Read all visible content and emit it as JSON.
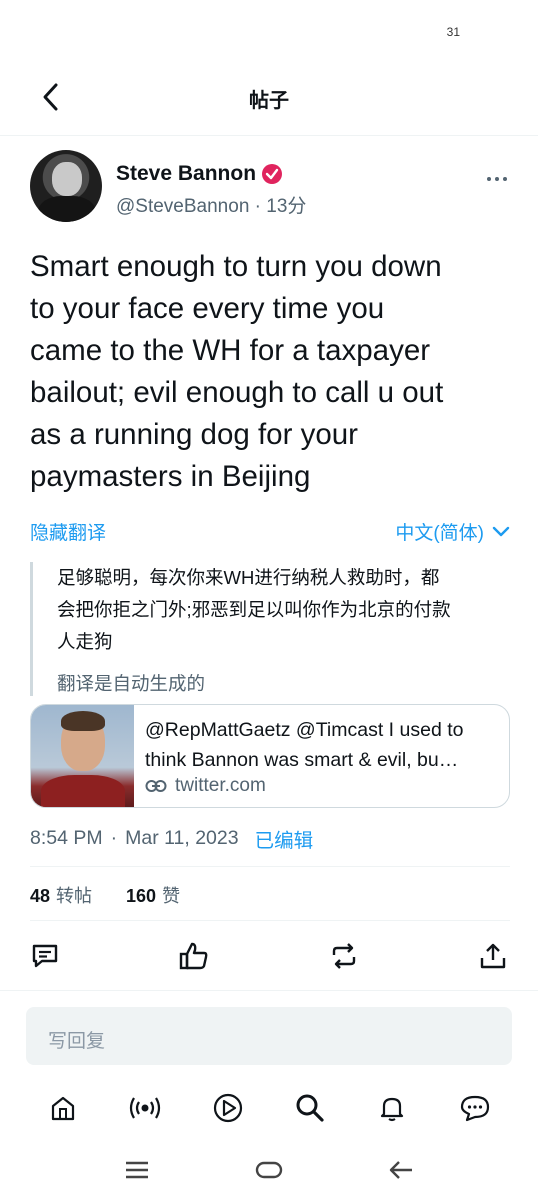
{
  "status_bar": {
    "number": "31"
  },
  "header": {
    "title": "帖子"
  },
  "author": {
    "name": "Steve Bannon",
    "handle": "@SteveBannon",
    "separator": "·",
    "time": "13分"
  },
  "tweet": {
    "lines": [
      "Smart enough to turn you down",
      "to your face every time you",
      "came to the WH for a taxpayer",
      "bailout; evil enough to call u out",
      "as a running dog for your",
      "paymasters in Beijing"
    ]
  },
  "translation": {
    "hide_label": "隐藏翻译",
    "language": "中文(简体)",
    "lines": [
      "足够聪明，每次你来WH进行纳税人救助时，都",
      "会把你拒之门外;邪恶到足以叫你作为北京的付款",
      "人走狗"
    ],
    "note": "翻译是自动生成的"
  },
  "quote": {
    "line1": "@RepMattGaetz @Timcast I used to",
    "line2": "think Bannon was smart & evil, bu…",
    "domain": "twitter.com"
  },
  "meta": {
    "time": "8:54 PM",
    "separator": "·",
    "date": "Mar 11, 2023",
    "edited": "已编辑"
  },
  "counts": {
    "retweets_value": "48",
    "retweets_label": "转帖",
    "likes_value": "160",
    "likes_label": "赞"
  },
  "actions": [
    "comment-icon",
    "thumbs-up-icon",
    "retweet-icon",
    "share-icon"
  ],
  "reply": {
    "placeholder": "写回复"
  },
  "bottom_nav": [
    "home-icon",
    "spaces-icon",
    "play-icon",
    "search-icon",
    "bell-icon",
    "messages-icon"
  ],
  "system_nav": [
    "menu-icon",
    "home-pill-icon",
    "back-arrow-icon"
  ],
  "colors": {
    "accent": "#1d9bf0",
    "verified": "#e0245e",
    "text": "#0f1419",
    "muted": "#536471"
  }
}
